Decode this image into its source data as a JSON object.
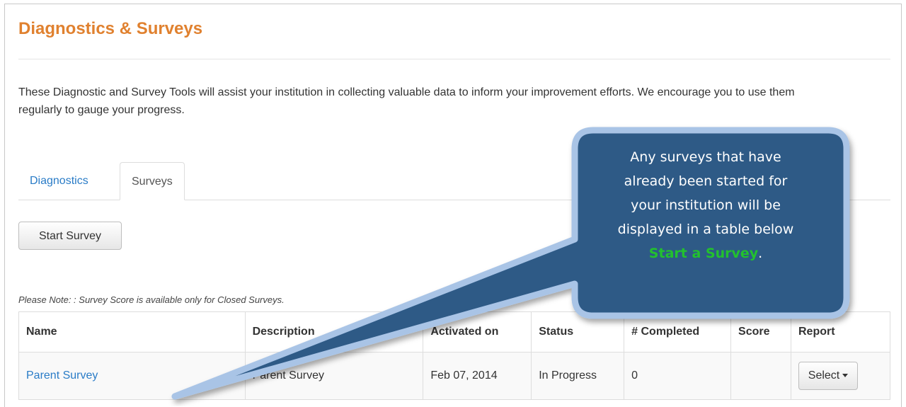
{
  "page": {
    "title": "Diagnostics & Surveys",
    "intro": "These Diagnostic and Survey Tools will assist your institution in collecting valuable data to inform your improvement efforts. We encourage you to use them regularly to gauge your progress."
  },
  "tabs": [
    {
      "label": "Diagnostics",
      "active": false
    },
    {
      "label": "Surveys",
      "active": true
    }
  ],
  "actions": {
    "start_survey_label": "Start Survey"
  },
  "note": "Please Note: : Survey Score is available only for Closed Surveys.",
  "table": {
    "headers": [
      "Name",
      "Description",
      "Activated on",
      "Status",
      "# Completed",
      "Score",
      "Report"
    ],
    "rows": [
      {
        "name": "Parent Survey",
        "description": "Parent Survey",
        "activated_on": "Feb 07, 2014",
        "status": "In Progress",
        "completed": "0",
        "score": "",
        "report_label": "Select"
      }
    ]
  },
  "callout": {
    "lines": [
      "Any surveys that have",
      "already been started for",
      "your institution will be",
      "displayed in a table below"
    ],
    "highlight": "Start a Survey",
    "suffix": ".",
    "fill_color": "#2e5a86",
    "border_color": "#a9c4e6",
    "highlight_color": "#22c12e"
  },
  "colors": {
    "title": "#e0812f",
    "link": "#2a7cc7"
  }
}
